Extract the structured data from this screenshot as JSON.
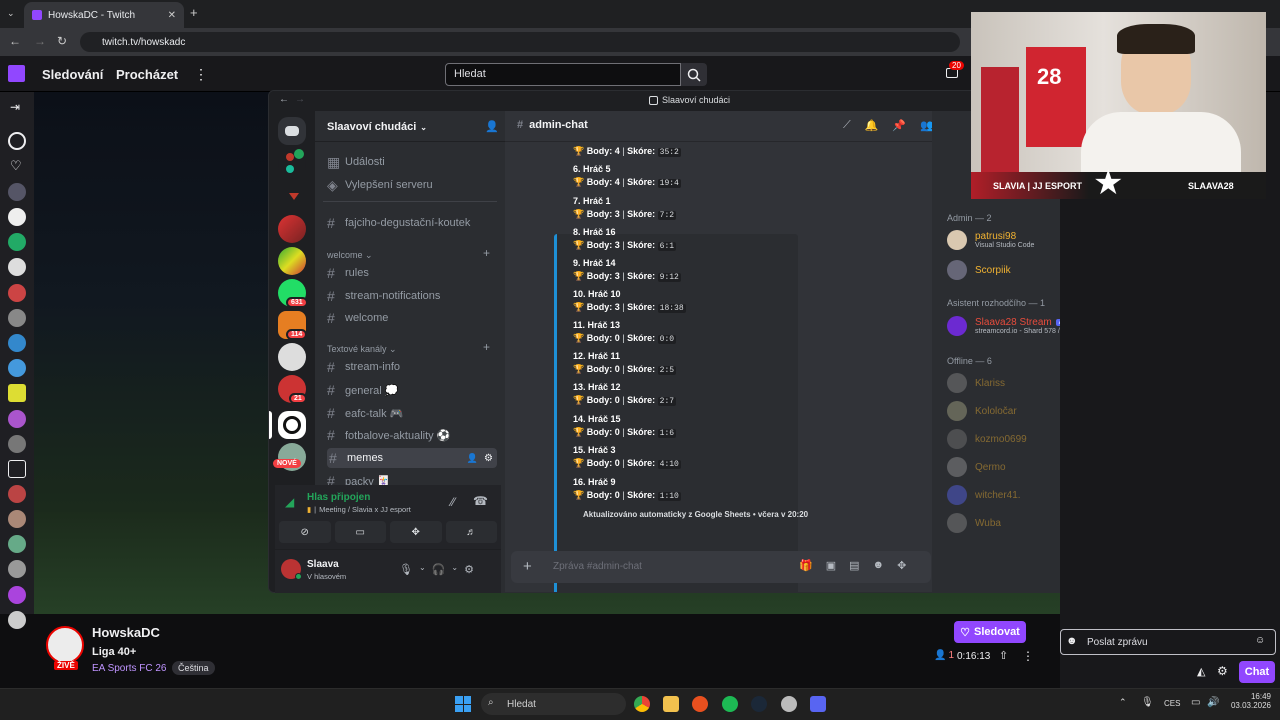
{
  "browser": {
    "tab_title": "HowskaDC - Twitch",
    "url": "twitch.tv/howskadc"
  },
  "twitch": {
    "nav_following": "Sledování",
    "nav_browse": "Procházet",
    "search_placeholder": "Hledat",
    "notif_count": "20",
    "channel_name": "HowskaDC",
    "stream_title": "Liga 40+",
    "game": "EA Sports FC 26",
    "language_tag": "Čeština",
    "live_badge": "ŽIVĚ",
    "follow_label": "Sledovat",
    "viewers": "1",
    "uptime": "0:16:13",
    "chat_placeholder": "Poslat zprávu",
    "chat_button": "Chat"
  },
  "discord": {
    "window_title": "Slaavoví chudáci",
    "server_name": "Slaavoví chudáci",
    "top_items": [
      "Události",
      "Vylepšení serveru"
    ],
    "channels_top": [
      "fajciho-degustační-koutek"
    ],
    "cat_welcome": "welcome",
    "welcome_channels": [
      "rules",
      "stream-notifications",
      "welcome"
    ],
    "cat_text": "Textové kanály",
    "text_channels": [
      "stream-info",
      "general 💭",
      "eafc-talk 🎮",
      "fotbalove-aktuality ⚽",
      "memes",
      "packy 🃏"
    ],
    "server_badges": {
      "b1": "631",
      "b2": "114",
      "b3": "21",
      "new": "NOVÉ"
    },
    "current_channel": "admin-chat",
    "embed_lines": [
      {
        "rank": "",
        "body": "4",
        "score": "35:2"
      },
      {
        "rank": "6. Hráč 5",
        "body": "4",
        "score": "19:4"
      },
      {
        "rank": "7. Hráč 1",
        "body": "3",
        "score": "7:2"
      },
      {
        "rank": "8. Hráč 16",
        "body": "3",
        "score": "6:1"
      },
      {
        "rank": "9. Hráč 14",
        "body": "3",
        "score": "9:12"
      },
      {
        "rank": "10. Hráč 10",
        "body": "3",
        "score": "18:38"
      },
      {
        "rank": "11. Hráč 13",
        "body": "0",
        "score": "0:0"
      },
      {
        "rank": "12. Hráč 11",
        "body": "0",
        "score": "2:5"
      },
      {
        "rank": "13. Hráč 12",
        "body": "0",
        "score": "2:7"
      },
      {
        "rank": "14. Hráč 15",
        "body": "0",
        "score": "1:6"
      },
      {
        "rank": "15. Hráč 3",
        "body": "0",
        "score": "4:10"
      },
      {
        "rank": "16. Hráč 9",
        "body": "0",
        "score": "1:10"
      }
    ],
    "body_label": "Body:",
    "score_label": "Skóre:",
    "embed_footer": "Aktualizováno automaticky z Google Sheets • včera v 20:20",
    "message_placeholder": "Zpráva #admin-chat",
    "voice_status": "Hlas připojen",
    "voice_channel": "Meeting / Slavia x JJ esport",
    "user_name": "Slaava",
    "user_status": "V hlasovém",
    "members": {
      "admin_header": "Admin — 2",
      "admins": [
        {
          "name": "patrusi98",
          "sub": "Visual Studio Code",
          "color": "#f0b232"
        },
        {
          "name": "Scorpiik",
          "sub": "",
          "color": "#f0b232"
        }
      ],
      "assistant_header": "Asistent rozhodčího — 1",
      "assistant": {
        "name": "Slaava28 Stream",
        "tag": "APP",
        "sub": "streamcord.io - Shard 578 / 800",
        "color": "#e74c3c"
      },
      "offline_header": "Offline — 6",
      "offline": [
        "Klariss",
        "Kololočar",
        "kozmo0699",
        "Qermo",
        "witcher41.",
        "Wuba"
      ]
    }
  },
  "webcam": {
    "banner_left": "SLAVIA | JJ ESPORT",
    "banner_right": "SLAAVA28",
    "shirt_number": "28"
  },
  "taskbar": {
    "search": "Hledat",
    "lang": "CES",
    "time": "16:49",
    "date": "03.03.2026"
  }
}
